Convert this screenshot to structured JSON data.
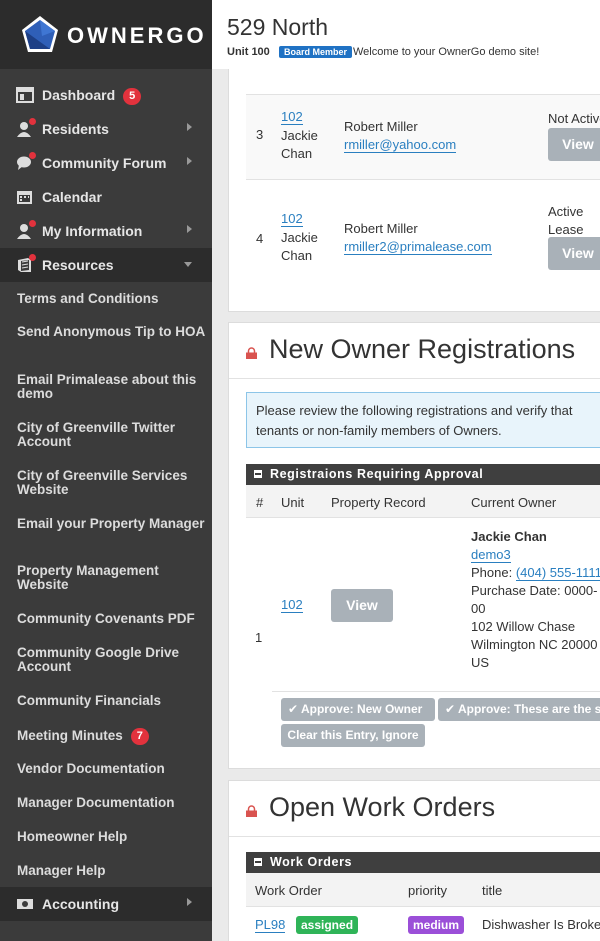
{
  "app": {
    "logo_text": "OWNERGO"
  },
  "header": {
    "title": "529 North",
    "unit": "Unit 100",
    "role_badge": "Board Member",
    "welcome": "Welcome to your OwnerGo demo site!"
  },
  "sidebar": {
    "nav": [
      {
        "label": "Dashboard",
        "badge": "5",
        "icon": "dashboard-icon"
      },
      {
        "label": "Residents",
        "icon": "user-icon"
      },
      {
        "label": "Community Forum",
        "icon": "chat-icon"
      },
      {
        "label": "Calendar",
        "icon": "calendar-icon"
      },
      {
        "label": "My Information",
        "icon": "user-icon"
      },
      {
        "label": "Resources",
        "icon": "book-icon"
      }
    ],
    "resources": [
      "Terms and Conditions",
      "Send Anonymous Tip to HOA",
      "Email Primalease about this demo",
      "City of Greenville Twitter Account",
      "City of Greenville Services Website",
      "Email your Property Manager",
      "Property Management Website",
      "Community Covenants PDF",
      "Community Google Drive Account",
      "Community Financials",
      "Meeting Minutes",
      "Vendor Documentation",
      "Manager Documentation",
      "Homeowner Help",
      "Manager Help"
    ],
    "meeting_minutes_badge": "7",
    "accounting": {
      "label": "Accounting",
      "icon": "money-icon"
    }
  },
  "lease_rows": [
    {
      "num": "3",
      "unit": "102",
      "name1": "Jackie",
      "name2": "Chan",
      "owner": "Robert Miller",
      "email": "rmiller@yahoo.com",
      "status1": "Not Active",
      "status2": "",
      "view": "View"
    },
    {
      "num": "4",
      "unit": "102",
      "name1": "Jackie",
      "name2": "Chan",
      "owner": "Robert Miller",
      "email": "rmiller2@primalease.com",
      "status1": "Active",
      "status2": "Lease",
      "view": "View"
    }
  ],
  "registrations": {
    "title": "New Owner Registrations",
    "notice_line1": "Please review the following registrations and verify that",
    "notice_line2": "tenants or non-family members of Owners.",
    "bar": "Registraions Requiring Approval",
    "headers": [
      "#",
      "Unit",
      "Property Record",
      "Current Owner"
    ],
    "row": {
      "num": "1",
      "unit": "102",
      "view": "View",
      "owner_name": "Jackie Chan",
      "owner_user": "demo3",
      "phone_label": "Phone:",
      "phone": "(404) 555-1111",
      "purchase_label": "Purchase Date: 0000-",
      "purchase_cont": "00",
      "addr1": "102 Willow Chase",
      "addr2": "Wilmington NC 20000",
      "addr3": "US"
    },
    "approve_owner": "Approve: New Owner",
    "approve_other": "Approve: These are the s",
    "clear": "Clear this Entry, Ignore"
  },
  "work_orders": {
    "title": "Open Work Orders",
    "bar": "Work Orders",
    "headers": [
      "Work Order",
      "priority",
      "title"
    ],
    "row": {
      "id": "PL98",
      "status": "assigned",
      "priority": "medium",
      "title": "Dishwasher Is Broke"
    }
  },
  "colors": {
    "sidebar": "#3b3b3b",
    "link": "#2a7fc0",
    "badge": "#e2323d",
    "assigned": "#2fb458",
    "medium": "#9b4fd8",
    "notice_bg": "#e8f4fb"
  }
}
